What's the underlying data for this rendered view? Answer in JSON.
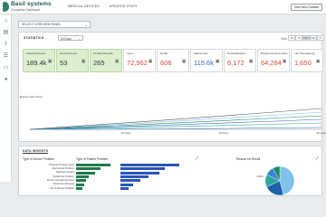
{
  "app": {
    "title": "Basil systems",
    "subtitle": "Competitor Dashboard"
  },
  "topnav": [
    "MEDICAL DEVICES",
    "UPDATED STATS"
  ],
  "top_button": "Start New Dataset",
  "panel_select": "SELECT A REVIEW PANEL",
  "stats": {
    "label": "STATISTICS",
    "range": "30 Days",
    "view_label": "View",
    "periods": [
      "1D",
      "7D",
      "30D",
      "90D",
      "1Y"
    ]
  },
  "kpis": [
    {
      "label": "Adverse Events",
      "value": "189.4k",
      "value_color": "#333333",
      "style": "green"
    },
    {
      "label": "Recall Events",
      "value": "53",
      "value_color": "#333333",
      "style": "green"
    },
    {
      "label": "Product Recalls",
      "value": "265",
      "value_color": "#333333",
      "style": "green"
    },
    {
      "label": "Injury",
      "value": "72,962",
      "value_color": "#d9463a",
      "style": "plain"
    },
    {
      "label": "Death",
      "value": "606",
      "value_color": "#d9463a",
      "style": "plain"
    },
    {
      "label": "Malfunction",
      "value": "115.6k",
      "value_color": "#3f62c8",
      "style": "plain"
    },
    {
      "label": "Hospitalization",
      "value": "6,172",
      "value_color": "#d9463a",
      "style": "plain"
    },
    {
      "label": "Required Intervention",
      "value": "64,284",
      "value_color": "#d9463a",
      "style": "plain"
    },
    {
      "label": "Life Threatening",
      "value": "1,650",
      "value_color": "#d9463a",
      "style": "plain"
    }
  ],
  "events_chart": {
    "label": "Events Over Time",
    "x_ticks": [
      "10 Days",
      "20 Days",
      "30 Days"
    ]
  },
  "insights": {
    "title": "DATA INSIGHTS",
    "left_title": "Type of Device Problem",
    "mid_title": "Type of Patient Problem",
    "right_title": "Reason for Recall",
    "device_problems": [
      {
        "label": "Physical Property Issue",
        "value": 100
      },
      {
        "label": "Mechanical Problem",
        "value": 72
      },
      {
        "label": "Material Integrity",
        "value": 55
      },
      {
        "label": "Positioning Problem",
        "value": 38
      },
      {
        "label": "Device Operational Issue",
        "value": 30
      },
      {
        "label": "Protective Measure",
        "value": 24
      },
      {
        "label": "Use of Device Problem",
        "value": 18
      }
    ],
    "patient_problems": [
      {
        "label": "",
        "value": 100
      },
      {
        "label": "",
        "value": 75
      },
      {
        "label": "",
        "value": 66
      },
      {
        "label": "",
        "value": 48
      },
      {
        "label": "",
        "value": 34
      },
      {
        "label": "",
        "value": 22
      },
      {
        "label": "",
        "value": 14
      }
    ],
    "recall_pie": [
      {
        "label": "Other",
        "value": 46,
        "color": "#7fc3e8"
      },
      {
        "label": "",
        "value": 22,
        "color": "#1e5fa8"
      },
      {
        "label": "",
        "value": 14,
        "color": "#2aa6a0"
      },
      {
        "label": "",
        "value": 10,
        "color": "#3b83d6"
      },
      {
        "label": "",
        "value": 8,
        "color": "#1b8a5a"
      }
    ]
  }
}
